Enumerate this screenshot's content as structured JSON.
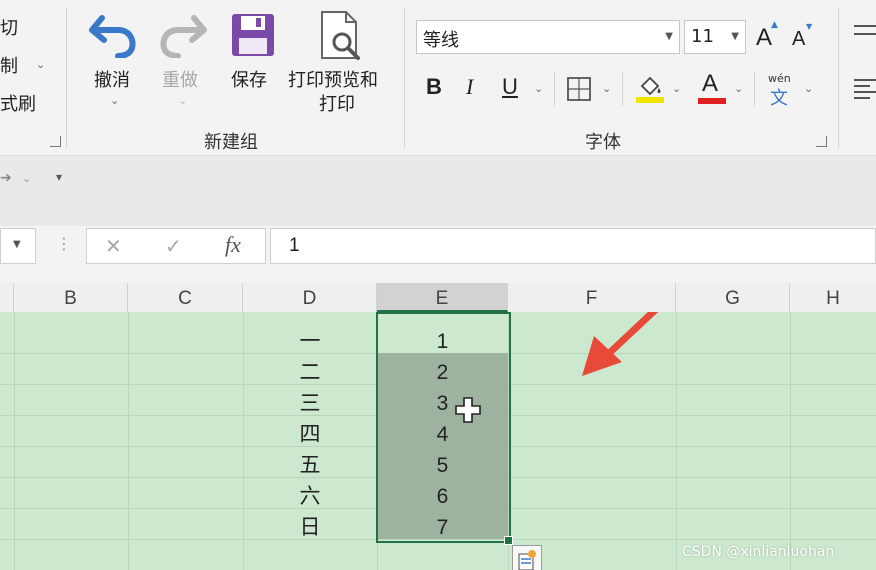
{
  "ribbon": {
    "clipboard": {
      "cut": "切",
      "copy": "制",
      "format_painter": "式刷"
    },
    "undo_label": "撤消",
    "redo_label": "重做",
    "save_label": "保存",
    "print_preview_label_line1": "打印预览和",
    "print_preview_label_line2": "打印",
    "group_new": "新建组",
    "font": {
      "name": "等线",
      "size": "11",
      "bold": "B",
      "italic": "I",
      "underline": "U",
      "phonetic_top": "wén",
      "phonetic_bottom": "文",
      "grow": "A",
      "shrink": "A",
      "font_color": "A",
      "fill_color_hex": "#f2e600",
      "font_color_hex": "#e02020",
      "group_label": "字体"
    }
  },
  "formula_bar": {
    "cancel": "✕",
    "enter": "✓",
    "fx": "fx",
    "value": "1"
  },
  "grid": {
    "columns": [
      "B",
      "C",
      "D",
      "E",
      "F",
      "G",
      "H"
    ],
    "column_d": [
      "一",
      "二",
      "三",
      "四",
      "五",
      "六",
      "日"
    ],
    "column_e": [
      "1",
      "2",
      "3",
      "4",
      "5",
      "6",
      "7"
    ]
  },
  "watermark": "CSDN @xinlianluohan",
  "colors": {
    "sheet_bg": "#cce8cf",
    "selection": "#9db39f",
    "selection_border": "#217346",
    "annotation_arrow": "#e84a3a",
    "undo_icon": "#3a78c8",
    "save_icon": "#7b4aa8"
  }
}
